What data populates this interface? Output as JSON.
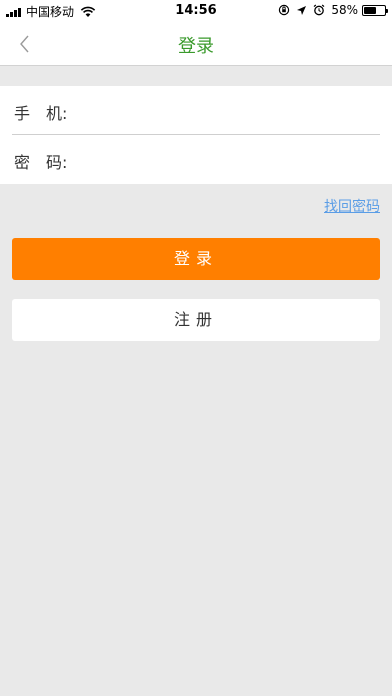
{
  "status_bar": {
    "carrier": "中国移动",
    "time": "14:56",
    "battery_percent": "58%",
    "battery_level": 0.58,
    "icons": [
      "signal-icon",
      "wifi-icon",
      "screen-lock-icon",
      "location-icon",
      "alarm-icon",
      "battery-icon"
    ]
  },
  "nav": {
    "title": "登录",
    "back_icon": "chevron-left-icon",
    "title_color": "#3a9a2c"
  },
  "form": {
    "phone_label": "手　机:",
    "phone_value": "",
    "password_label": "密　码:",
    "password_value": ""
  },
  "links": {
    "forgot_password": "找回密码"
  },
  "buttons": {
    "login_label": "登录",
    "register_label": "注册"
  },
  "colors": {
    "accent": "#ff7f00",
    "title_green": "#3a9a2c",
    "link_blue": "#5a9de6",
    "background": "#e9e9e9"
  }
}
